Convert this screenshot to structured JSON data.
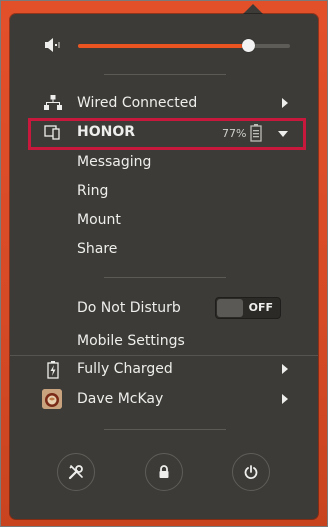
{
  "volume": {
    "level": 0.8,
    "icon": "speaker-icon"
  },
  "network": {
    "label": "Wired Connected",
    "icon": "wired-network-icon"
  },
  "device": {
    "name": "HONOR",
    "battery_percent": "77%",
    "icon": "phone-icon",
    "actions": [
      "Messaging",
      "Ring",
      "Mount",
      "Share"
    ]
  },
  "dnd": {
    "label": "Do Not Disturb",
    "toggle_label": "OFF"
  },
  "mobile_settings": {
    "label": "Mobile Settings"
  },
  "battery": {
    "label": "Fully Charged",
    "icon": "battery-charging-icon"
  },
  "user": {
    "name": "Dave McKay",
    "icon": "avatar"
  },
  "bottom_buttons": [
    "settings-icon",
    "lock-icon",
    "power-icon"
  ],
  "colors": {
    "accent": "#e95420",
    "popup_bg": "#3c3b37",
    "highlight": "#c8193c"
  }
}
